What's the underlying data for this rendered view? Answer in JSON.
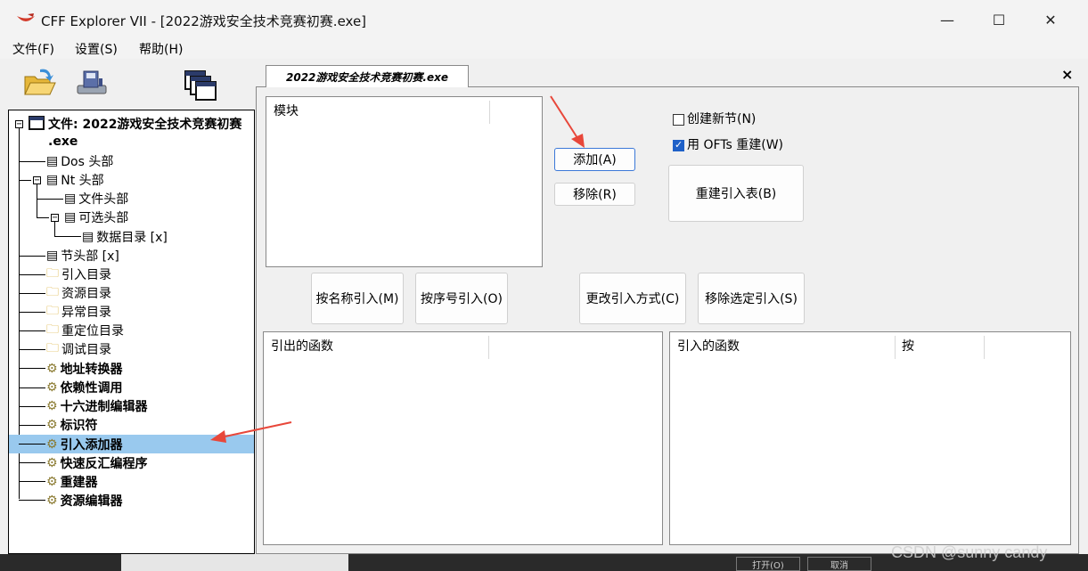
{
  "window": {
    "title": "CFF Explorer VII - [2022游戏安全技术竞赛初赛.exe]",
    "minimize": "—",
    "maximize": "☐",
    "close": "✕"
  },
  "menubar": [
    "文件(F)",
    "设置(S)",
    "帮助(H)"
  ],
  "toolbar": [
    "open-folder-icon",
    "save-disk-icon",
    "windows-icon"
  ],
  "tree": {
    "root_label_line1": "文件: 2022游戏安全技术竞赛初赛",
    "root_label_line2": ".exe",
    "items": [
      {
        "label": "Dos 头部",
        "icon": "doc-icon"
      },
      {
        "label": "Nt 头部",
        "icon": "doc-icon"
      },
      {
        "label": "文件头部",
        "icon": "doc-icon"
      },
      {
        "label": "可选头部",
        "icon": "doc-icon"
      },
      {
        "label": "数据目录 [x]",
        "icon": "doc-icon"
      },
      {
        "label": "节头部 [x]",
        "icon": "doc-icon"
      },
      {
        "label": "引入目录",
        "icon": "folder-icon"
      },
      {
        "label": "资源目录",
        "icon": "folder-icon"
      },
      {
        "label": "异常目录",
        "icon": "folder-icon"
      },
      {
        "label": "重定位目录",
        "icon": "folder-icon"
      },
      {
        "label": "调试目录",
        "icon": "folder-icon"
      },
      {
        "label": "地址转换器",
        "icon": "tool-icon"
      },
      {
        "label": "依赖性调用",
        "icon": "tool-icon"
      },
      {
        "label": "十六进制编辑器",
        "icon": "tool-icon"
      },
      {
        "label": "标识符",
        "icon": "tool-icon"
      },
      {
        "label": "引入添加器",
        "icon": "tool-icon"
      },
      {
        "label": "快速反汇编程序",
        "icon": "tool-icon"
      },
      {
        "label": "重建器",
        "icon": "tool-icon"
      },
      {
        "label": "资源编辑器",
        "icon": "tool-icon"
      }
    ],
    "selected": "引入添加器"
  },
  "tab": {
    "label": "2022游戏安全技术竞赛初赛.exe",
    "close": "×"
  },
  "modules_list": {
    "header": "模块"
  },
  "buttons": {
    "add": "添加(A)",
    "remove": "移除(R)",
    "rebuild_import_table": "重建引入表(B)",
    "by_name": "按名称引入(M)",
    "by_ordinal": "按序号引入(O)",
    "change_method": "更改引入方式(C)",
    "remove_selected": "移除选定引入(S)"
  },
  "options": {
    "create_new_section": {
      "label": "创建新节(N)",
      "checked": false
    },
    "use_ofts": {
      "label": "用 OFTs 重建(W)",
      "checked": true
    }
  },
  "exported_list": {
    "header": "引出的函数"
  },
  "imported_list": {
    "header": "引入的函数",
    "header2": "按"
  },
  "background_dialog": {
    "open": "打开(O)",
    "cancel": "取消"
  },
  "watermark": "CSDN @sunny candy",
  "colors": {
    "accent_arrow": "#e8473a",
    "selection": "#99c9ee"
  }
}
